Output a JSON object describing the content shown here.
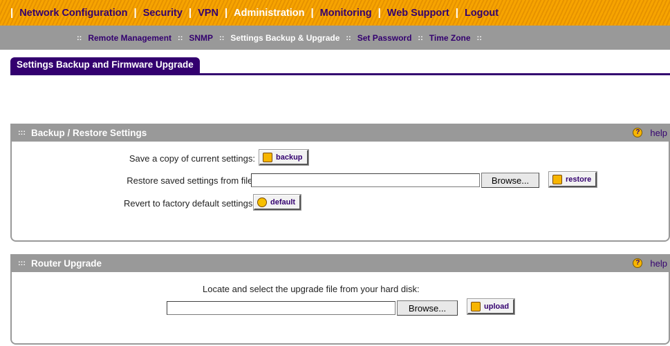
{
  "topnav": {
    "items": [
      {
        "label": "Network Configuration",
        "active": false
      },
      {
        "label": "Security",
        "active": false
      },
      {
        "label": "VPN",
        "active": false
      },
      {
        "label": "Administration",
        "active": true
      },
      {
        "label": "Monitoring",
        "active": false
      },
      {
        "label": "Web Support",
        "active": false
      },
      {
        "label": "Logout",
        "active": false
      }
    ],
    "separator": "|"
  },
  "subnav": {
    "separator": "::",
    "items": [
      {
        "label": "Remote Management",
        "active": false
      },
      {
        "label": "SNMP",
        "active": false
      },
      {
        "label": "Settings Backup & Upgrade",
        "active": true
      },
      {
        "label": "Set Password",
        "active": false
      },
      {
        "label": "Time Zone",
        "active": false
      }
    ]
  },
  "tab": {
    "label": "Settings Backup and Firmware Upgrade"
  },
  "backup_section": {
    "title": "Backup / Restore Settings",
    "help_label": "help",
    "grip": ":::",
    "save_label": "Save a copy of current settings:",
    "backup_button": "backup",
    "restore_label": "Restore saved settings from file:",
    "restore_file_value": "",
    "browse_label": "Browse...",
    "restore_button": "restore",
    "factory_label": "Revert to factory default settings:",
    "default_button": "default"
  },
  "upgrade_section": {
    "title": "Router Upgrade",
    "help_label": "help",
    "grip": ":::",
    "instruction": "Locate and select the upgrade file from your hard disk:",
    "upgrade_file_value": "",
    "browse_label": "Browse...",
    "upload_button": "upload"
  },
  "colors": {
    "nav_orange": "#f7a400",
    "brand_purple": "#33006f",
    "section_gray": "#999999",
    "icon_yellow": "#f7b500"
  }
}
